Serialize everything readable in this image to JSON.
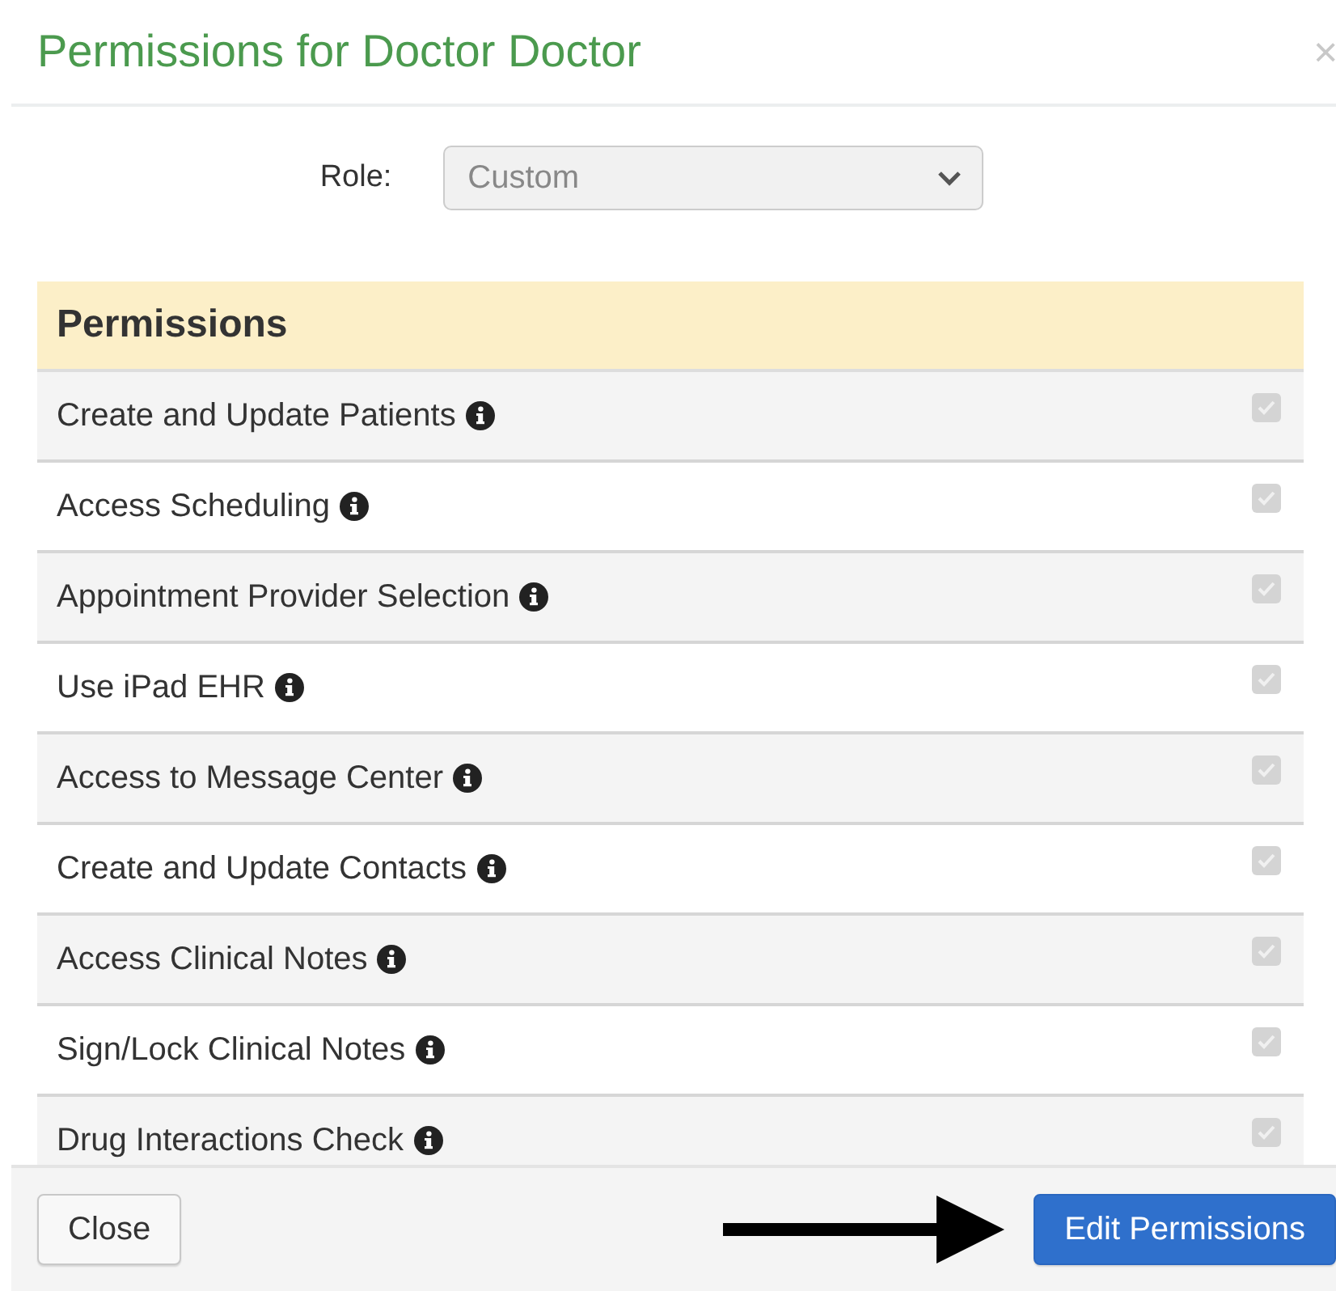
{
  "dialog": {
    "title": "Permissions for Doctor Doctor",
    "close_glyph": "×"
  },
  "role": {
    "label": "Role:",
    "value": "Custom",
    "disabled": true
  },
  "permissions": {
    "heading": "Permissions",
    "rows": [
      {
        "label": "Create and Update Patients",
        "checked": true,
        "disabled": true
      },
      {
        "label": "Access Scheduling",
        "checked": true,
        "disabled": true
      },
      {
        "label": "Appointment Provider Selection",
        "checked": true,
        "disabled": true
      },
      {
        "label": "Use iPad EHR",
        "checked": true,
        "disabled": true
      },
      {
        "label": "Access to Message Center",
        "checked": true,
        "disabled": true
      },
      {
        "label": "Create and Update Contacts",
        "checked": true,
        "disabled": true
      },
      {
        "label": "Access Clinical Notes",
        "checked": true,
        "disabled": true
      },
      {
        "label": "Sign/Lock Clinical Notes",
        "checked": true,
        "disabled": true
      },
      {
        "label": "Drug Interactions Check",
        "checked": true,
        "disabled": true
      }
    ]
  },
  "footer": {
    "buttons": [
      {
        "label": "Close",
        "kind": "default"
      },
      {
        "label": "Edit Permissions",
        "kind": "primary"
      }
    ]
  }
}
